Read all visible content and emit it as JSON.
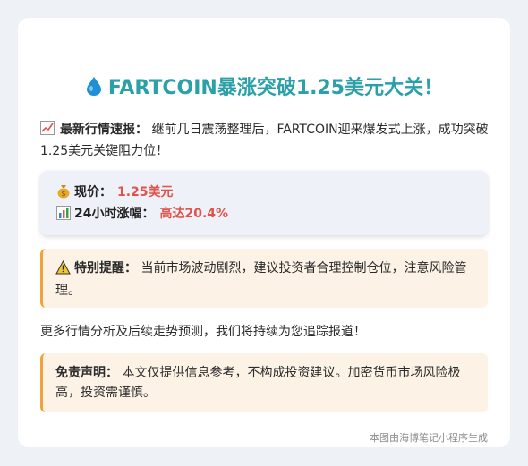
{
  "title": {
    "icon": "water-drop-icon",
    "text": "FARTCOIN暴涨突破1.25美元大关！"
  },
  "intro": {
    "icon": "chart-up-icon",
    "label": "最新行情速报：",
    "text": "继前几日震荡整理后，FARTCOIN迎来爆发式上涨，成功突破1.25美元关键阻力位！"
  },
  "price_box": {
    "price_icon": "money-bag-icon",
    "price_label": "现价：",
    "price_value": "1.25美元",
    "change_icon": "bar-chart-icon",
    "change_label": "24小时涨幅：",
    "change_value": "高达20.4%"
  },
  "warning": {
    "icon": "warning-icon",
    "label": "特别提醒：",
    "text": "当前市场波动剧烈，建议投资者合理控制仓位，注意风险管理。"
  },
  "more_text": "更多行情分析及后续走势预测，我们将持续为您追踪报道！",
  "disclaimer": {
    "label": "免责声明：",
    "text": "本文仅提供信息参考，不构成投资建议。加密货币市场风险极高，投资需谨慎。"
  },
  "footer": "本图由海博笔记小程序生成",
  "colors": {
    "title": "#2aa0a8",
    "highlight": "#e0524a",
    "note_border": "#f0a33a",
    "note_bg": "#fdf2e6",
    "price_bg": "#eef1f7"
  }
}
